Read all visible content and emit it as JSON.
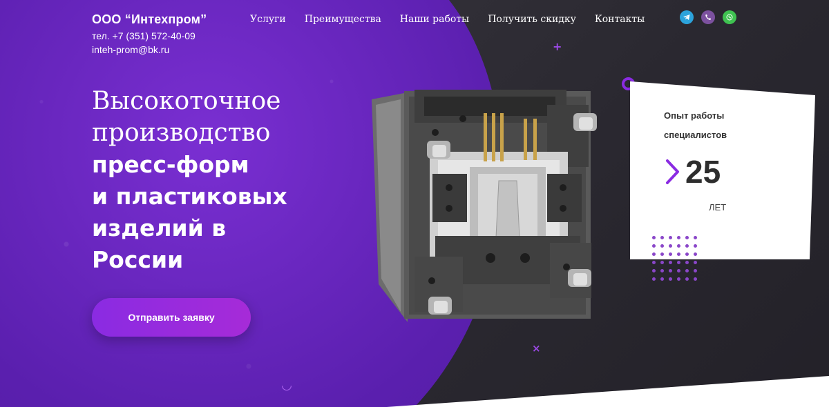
{
  "header": {
    "company": "ООО “Интехпром”",
    "phone": "тел. +7 (351) 572-40-09",
    "email": "inteh-prom@bk.ru",
    "nav": [
      "Услуги",
      "Преимущества",
      "Наши работы",
      "Получить скидку",
      "Контакты"
    ],
    "socials": [
      "telegram-icon",
      "viber-icon",
      "whatsapp-icon"
    ]
  },
  "hero": {
    "line1": "Высокоточное",
    "line2": "производство",
    "line3": "пресс-форм",
    "line4": "и пластиковых",
    "line5": "изделий в",
    "line6": "России",
    "cta": "Отправить заявку"
  },
  "card": {
    "label1": "Опыт работы",
    "label2": "специалистов",
    "value": "25",
    "unit": "ЛЕТ"
  },
  "colors": {
    "accent": "#8a2be2",
    "purple_bg": "#5a1fae",
    "dark_bg": "#2a2830"
  }
}
